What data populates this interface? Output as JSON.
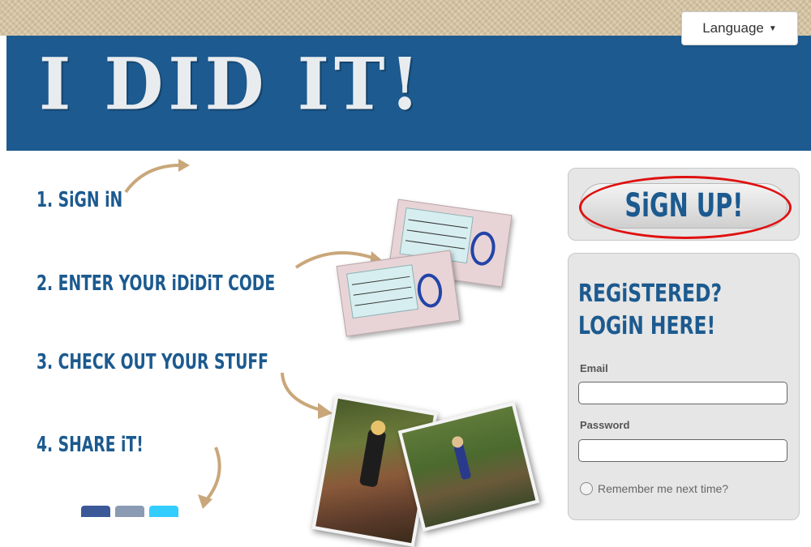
{
  "header": {
    "logo_text": "I DID IT!",
    "language_label": "Language"
  },
  "steps": [
    {
      "label": "1. SiGN iN"
    },
    {
      "label": "2. ENTER YOUR iDiDiT CODE"
    },
    {
      "label": "3. CHECK OUT YOUR STUFF"
    },
    {
      "label": "4. SHARE iT!"
    }
  ],
  "signup": {
    "button_label": "SiGN UP!"
  },
  "login": {
    "title": "REGiSTERED? LOGiN HERE!",
    "email_label": "Email",
    "password_label": "Password",
    "remember_label": "Remember me next time?"
  },
  "colors": {
    "brand_blue": "#1c5a8f",
    "highlight": "#e01010",
    "arrow": "#c9a77a"
  }
}
